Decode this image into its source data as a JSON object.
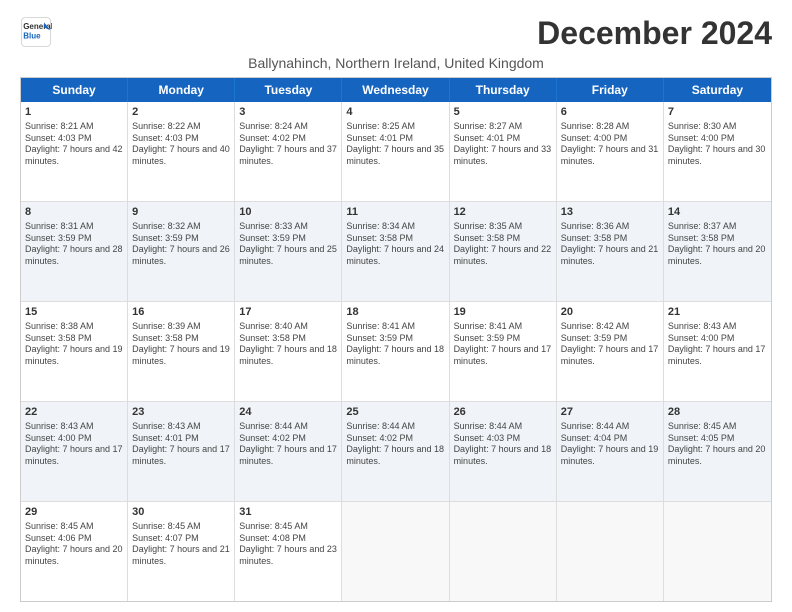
{
  "logo": {
    "line1": "General",
    "line2": "Blue"
  },
  "title": "December 2024",
  "subtitle": "Ballynahinch, Northern Ireland, United Kingdom",
  "days": [
    "Sunday",
    "Monday",
    "Tuesday",
    "Wednesday",
    "Thursday",
    "Friday",
    "Saturday"
  ],
  "weeks": [
    [
      {
        "day": "1",
        "rise": "8:21 AM",
        "set": "4:03 PM",
        "daylight": "7 hours and 42 minutes."
      },
      {
        "day": "2",
        "rise": "8:22 AM",
        "set": "4:03 PM",
        "daylight": "7 hours and 40 minutes."
      },
      {
        "day": "3",
        "rise": "8:24 AM",
        "set": "4:02 PM",
        "daylight": "7 hours and 37 minutes."
      },
      {
        "day": "4",
        "rise": "8:25 AM",
        "set": "4:01 PM",
        "daylight": "7 hours and 35 minutes."
      },
      {
        "day": "5",
        "rise": "8:27 AM",
        "set": "4:01 PM",
        "daylight": "7 hours and 33 minutes."
      },
      {
        "day": "6",
        "rise": "8:28 AM",
        "set": "4:00 PM",
        "daylight": "7 hours and 31 minutes."
      },
      {
        "day": "7",
        "rise": "8:30 AM",
        "set": "4:00 PM",
        "daylight": "7 hours and 30 minutes."
      }
    ],
    [
      {
        "day": "8",
        "rise": "8:31 AM",
        "set": "3:59 PM",
        "daylight": "7 hours and 28 minutes."
      },
      {
        "day": "9",
        "rise": "8:32 AM",
        "set": "3:59 PM",
        "daylight": "7 hours and 26 minutes."
      },
      {
        "day": "10",
        "rise": "8:33 AM",
        "set": "3:59 PM",
        "daylight": "7 hours and 25 minutes."
      },
      {
        "day": "11",
        "rise": "8:34 AM",
        "set": "3:58 PM",
        "daylight": "7 hours and 24 minutes."
      },
      {
        "day": "12",
        "rise": "8:35 AM",
        "set": "3:58 PM",
        "daylight": "7 hours and 22 minutes."
      },
      {
        "day": "13",
        "rise": "8:36 AM",
        "set": "3:58 PM",
        "daylight": "7 hours and 21 minutes."
      },
      {
        "day": "14",
        "rise": "8:37 AM",
        "set": "3:58 PM",
        "daylight": "7 hours and 20 minutes."
      }
    ],
    [
      {
        "day": "15",
        "rise": "8:38 AM",
        "set": "3:58 PM",
        "daylight": "7 hours and 19 minutes."
      },
      {
        "day": "16",
        "rise": "8:39 AM",
        "set": "3:58 PM",
        "daylight": "7 hours and 19 minutes."
      },
      {
        "day": "17",
        "rise": "8:40 AM",
        "set": "3:58 PM",
        "daylight": "7 hours and 18 minutes."
      },
      {
        "day": "18",
        "rise": "8:41 AM",
        "set": "3:59 PM",
        "daylight": "7 hours and 18 minutes."
      },
      {
        "day": "19",
        "rise": "8:41 AM",
        "set": "3:59 PM",
        "daylight": "7 hours and 17 minutes."
      },
      {
        "day": "20",
        "rise": "8:42 AM",
        "set": "3:59 PM",
        "daylight": "7 hours and 17 minutes."
      },
      {
        "day": "21",
        "rise": "8:43 AM",
        "set": "4:00 PM",
        "daylight": "7 hours and 17 minutes."
      }
    ],
    [
      {
        "day": "22",
        "rise": "8:43 AM",
        "set": "4:00 PM",
        "daylight": "7 hours and 17 minutes."
      },
      {
        "day": "23",
        "rise": "8:43 AM",
        "set": "4:01 PM",
        "daylight": "7 hours and 17 minutes."
      },
      {
        "day": "24",
        "rise": "8:44 AM",
        "set": "4:02 PM",
        "daylight": "7 hours and 17 minutes."
      },
      {
        "day": "25",
        "rise": "8:44 AM",
        "set": "4:02 PM",
        "daylight": "7 hours and 18 minutes."
      },
      {
        "day": "26",
        "rise": "8:44 AM",
        "set": "4:03 PM",
        "daylight": "7 hours and 18 minutes."
      },
      {
        "day": "27",
        "rise": "8:44 AM",
        "set": "4:04 PM",
        "daylight": "7 hours and 19 minutes."
      },
      {
        "day": "28",
        "rise": "8:45 AM",
        "set": "4:05 PM",
        "daylight": "7 hours and 20 minutes."
      }
    ],
    [
      {
        "day": "29",
        "rise": "8:45 AM",
        "set": "4:06 PM",
        "daylight": "7 hours and 20 minutes."
      },
      {
        "day": "30",
        "rise": "8:45 AM",
        "set": "4:07 PM",
        "daylight": "7 hours and 21 minutes."
      },
      {
        "day": "31",
        "rise": "8:45 AM",
        "set": "4:08 PM",
        "daylight": "7 hours and 23 minutes."
      },
      null,
      null,
      null,
      null
    ]
  ],
  "week_alt": [
    false,
    true,
    false,
    true,
    false
  ]
}
